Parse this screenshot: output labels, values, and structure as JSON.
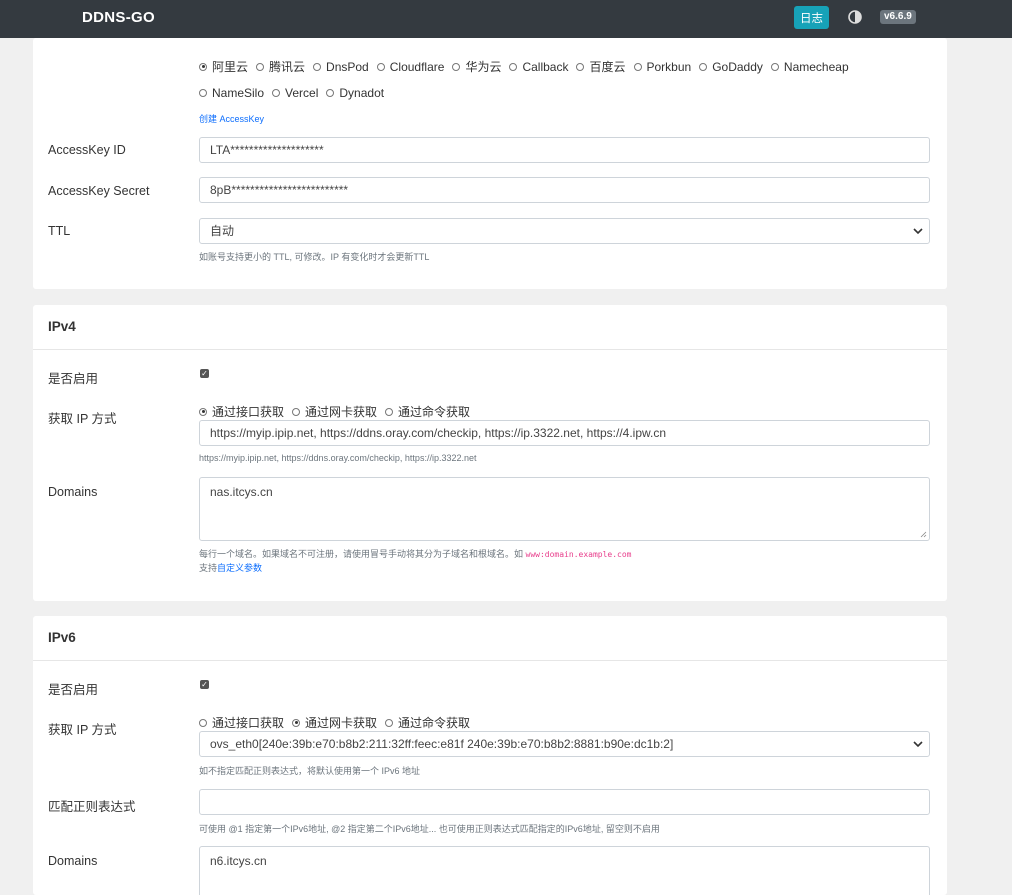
{
  "header": {
    "brand": "DDNS-GO",
    "log_button": "日志",
    "version": "v6.6.9"
  },
  "dns": {
    "providers_row1": [
      {
        "label": "阿里云",
        "selected": true
      },
      {
        "label": "腾讯云",
        "selected": false
      },
      {
        "label": "DnsPod",
        "selected": false
      },
      {
        "label": "Cloudflare",
        "selected": false
      },
      {
        "label": "华为云",
        "selected": false
      },
      {
        "label": "Callback",
        "selected": false
      },
      {
        "label": "百度云",
        "selected": false
      },
      {
        "label": "Porkbun",
        "selected": false
      },
      {
        "label": "GoDaddy",
        "selected": false
      },
      {
        "label": "Namecheap",
        "selected": false
      }
    ],
    "providers_row2": [
      {
        "label": "NameSilo",
        "selected": false
      },
      {
        "label": "Vercel",
        "selected": false
      },
      {
        "label": "Dynadot",
        "selected": false
      }
    ],
    "create_key_link": "创建 AccessKey",
    "access_key_id_label": "AccessKey ID",
    "access_key_id_value": "LTA********************",
    "access_key_secret_label": "AccessKey Secret",
    "access_key_secret_value": "8pB*************************",
    "ttl_label": "TTL",
    "ttl_value": "自动",
    "ttl_help": "如账号支持更小的 TTL, 可修改。IP 有变化时才会更新TTL"
  },
  "ipv4": {
    "title": "IPv4",
    "enable_label": "是否启用",
    "enabled": true,
    "method_label": "获取 IP 方式",
    "methods": [
      {
        "label": "通过接口获取",
        "selected": true
      },
      {
        "label": "通过网卡获取",
        "selected": false
      },
      {
        "label": "通过命令获取",
        "selected": false
      }
    ],
    "url_value": "https://myip.ipip.net, https://ddns.oray.com/checkip, https://ip.3322.net, https://4.ipw.cn",
    "url_help": "https://myip.ipip.net, https://ddns.oray.com/checkip, https://ip.3322.net",
    "domains_label": "Domains",
    "domains_value": "nas.itcys.cn",
    "domains_help_text": "每行一个域名。如果域名不可注册，请使用冒号手动将其分为子域名和根域名。如",
    "domains_help_code": "www:domain.example.com",
    "custom_params_prefix": "支持",
    "custom_params_link": "自定义参数"
  },
  "ipv6": {
    "title": "IPv6",
    "enable_label": "是否启用",
    "enabled": true,
    "method_label": "获取 IP 方式",
    "methods": [
      {
        "label": "通过接口获取",
        "selected": false
      },
      {
        "label": "通过网卡获取",
        "selected": true
      },
      {
        "label": "通过命令获取",
        "selected": false
      }
    ],
    "netcard_value": "ovs_eth0[240e:39b:e70:b8b2:211:32ff:feec:e81f 240e:39b:e70:b8b2:8881:b90e:dc1b:2]",
    "netcard_help": "如不指定匹配正则表达式，将默认使用第一个 IPv6 地址",
    "regex_label": "匹配正则表达式",
    "regex_value": "",
    "regex_help": "可使用 @1 指定第一个IPv6地址, @2 指定第二个IPv6地址... 也可使用正则表达式匹配指定的IPv6地址, 留空则不启用",
    "domains_label": "Domains",
    "domains_value": "n6.itcys.cn"
  }
}
